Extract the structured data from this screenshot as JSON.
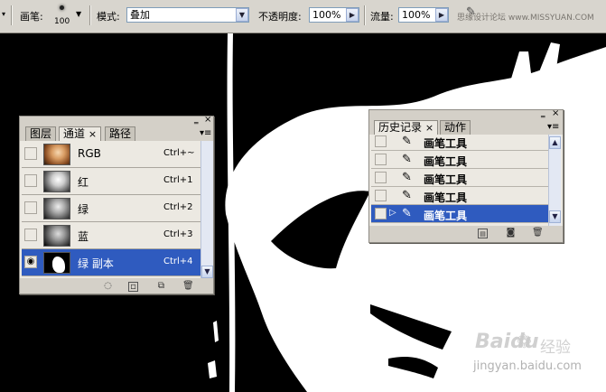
{
  "options_bar": {
    "brush_label": "画笔:",
    "brush_size": "100",
    "mode_label": "模式:",
    "mode_value": "叠加",
    "opacity_label": "不透明度:",
    "opacity_value": "100%",
    "flow_label": "流量:",
    "flow_value": "100%",
    "watermark": "思缘设计论坛 www.MISSYUAN.COM"
  },
  "channels_panel": {
    "tabs": [
      "图层",
      "通道",
      "路径"
    ],
    "close_glyph": "×",
    "menu_glyph": "≡",
    "channels": [
      {
        "name": "RGB",
        "shortcut": "Ctrl+~",
        "visible": false,
        "selected": false
      },
      {
        "name": "红",
        "shortcut": "Ctrl+1",
        "visible": false,
        "selected": false
      },
      {
        "name": "绿",
        "shortcut": "Ctrl+2",
        "visible": false,
        "selected": false
      },
      {
        "name": "蓝",
        "shortcut": "Ctrl+3",
        "visible": false,
        "selected": false
      },
      {
        "name": "绿 副本",
        "shortcut": "Ctrl+4",
        "visible": true,
        "selected": true
      }
    ]
  },
  "history_panel": {
    "tabs": [
      "历史记录",
      "动作"
    ],
    "close_glyph": "×",
    "items": [
      {
        "name": "画笔工具",
        "selected": false
      },
      {
        "name": "画笔工具",
        "selected": false
      },
      {
        "name": "画笔工具",
        "selected": false
      },
      {
        "name": "画笔工具",
        "selected": false
      },
      {
        "name": "画笔工具",
        "selected": true
      }
    ]
  },
  "watermark_bottom": {
    "logo_text": "Baidu",
    "logo_suffix": "经验",
    "url": "jingyan.baidu.com"
  },
  "colors": {
    "panel_bg": "#d4d0c8",
    "selection": "#2f5bbf",
    "canvas_black": "#000000",
    "canvas_white": "#ffffff"
  }
}
